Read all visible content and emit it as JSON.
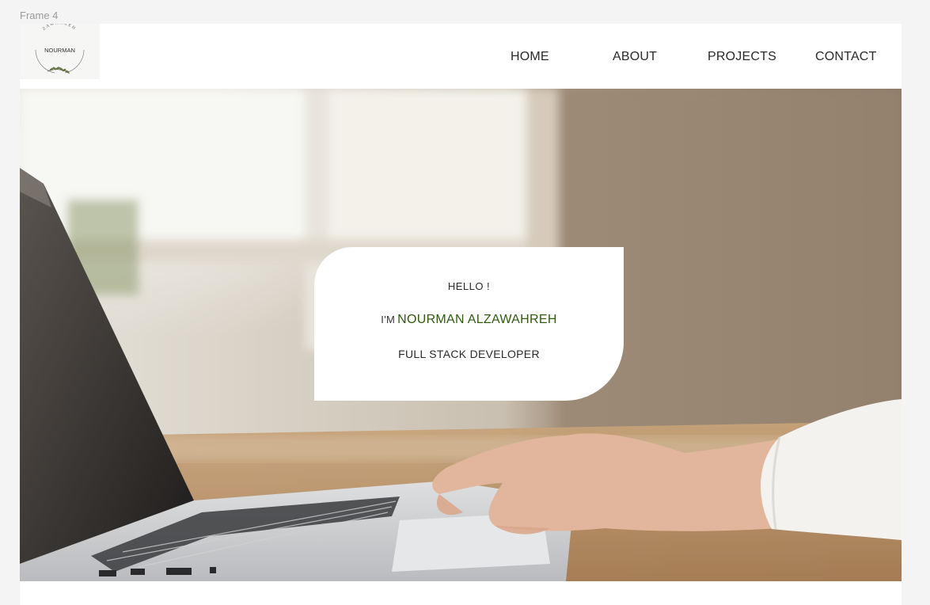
{
  "frame": {
    "label": "Frame 4"
  },
  "logo": {
    "arc_text": "ZAWAHREH",
    "name": "NOURMAN",
    "icon": "olive-branch-icon"
  },
  "nav": {
    "items": [
      {
        "label": "HOME"
      },
      {
        "label": "ABOUT"
      },
      {
        "label": "PROJECTS"
      },
      {
        "label": "CONTACT"
      }
    ]
  },
  "hero": {
    "background_image": "laptop-typing-photo",
    "card": {
      "greeting": "HELLO !",
      "intro_prefix": "I'M",
      "name": "NOURMAN ALZAWAHREH",
      "role": "FULL STACK DEVELOPER"
    }
  },
  "colors": {
    "accent_name": "#2f5a10",
    "text": "#2a2a2a",
    "background": "#f4f4f4"
  }
}
